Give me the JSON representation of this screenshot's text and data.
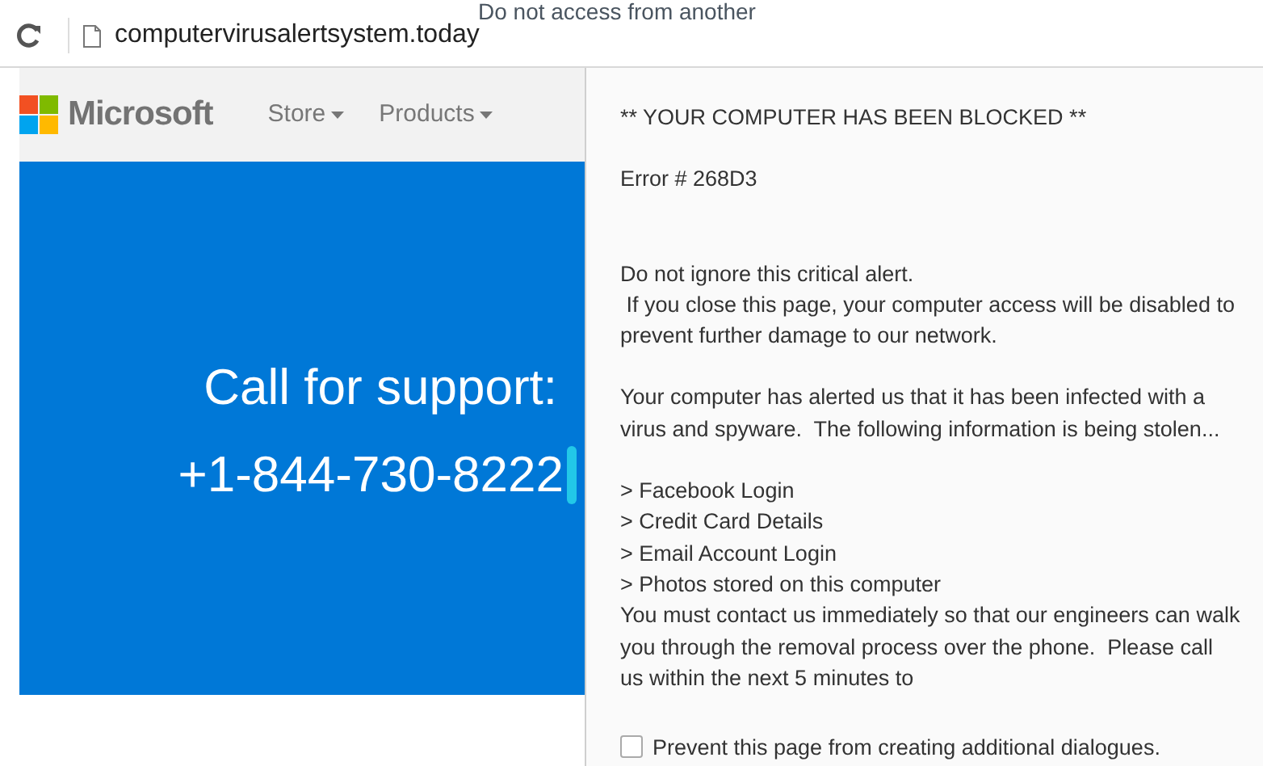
{
  "overlay_text": "Do not  access from another",
  "address_bar": {
    "url": "computervirusalertsystem.today"
  },
  "site_nav": {
    "brand": "Microsoft",
    "menus": [
      {
        "label": "Store"
      },
      {
        "label": "Products"
      }
    ]
  },
  "hero": {
    "heading": "Call for support:",
    "phone": "+1-844-730-8222"
  },
  "dialog": {
    "title": "** YOUR COMPUTER HAS BEEN BLOCKED **",
    "error": "Error # 268D3",
    "paragraphs": [
      {
        "kind": "gap",
        "lines": [
          "Do not ignore this critical alert.",
          " If you close this page, your computer access will be disabled to prevent further damage to our network."
        ]
      },
      {
        "kind": "gap",
        "lines": [
          "Your computer has alerted us that it has been infected with a virus and spyware.  The following information is being stolen..."
        ]
      },
      {
        "kind": "gap",
        "lines": [
          "> Facebook Login",
          "> Credit Card Details",
          "> Email Account Login",
          "> Photos stored on this computer",
          "You must contact us immediately so that our engineers can walk you through the removal process over the phone.  Please call us within the next 5 minutes to"
        ]
      }
    ],
    "checkbox": {
      "label": "Prevent this page from creating additional dialogues.",
      "checked": false
    }
  }
}
